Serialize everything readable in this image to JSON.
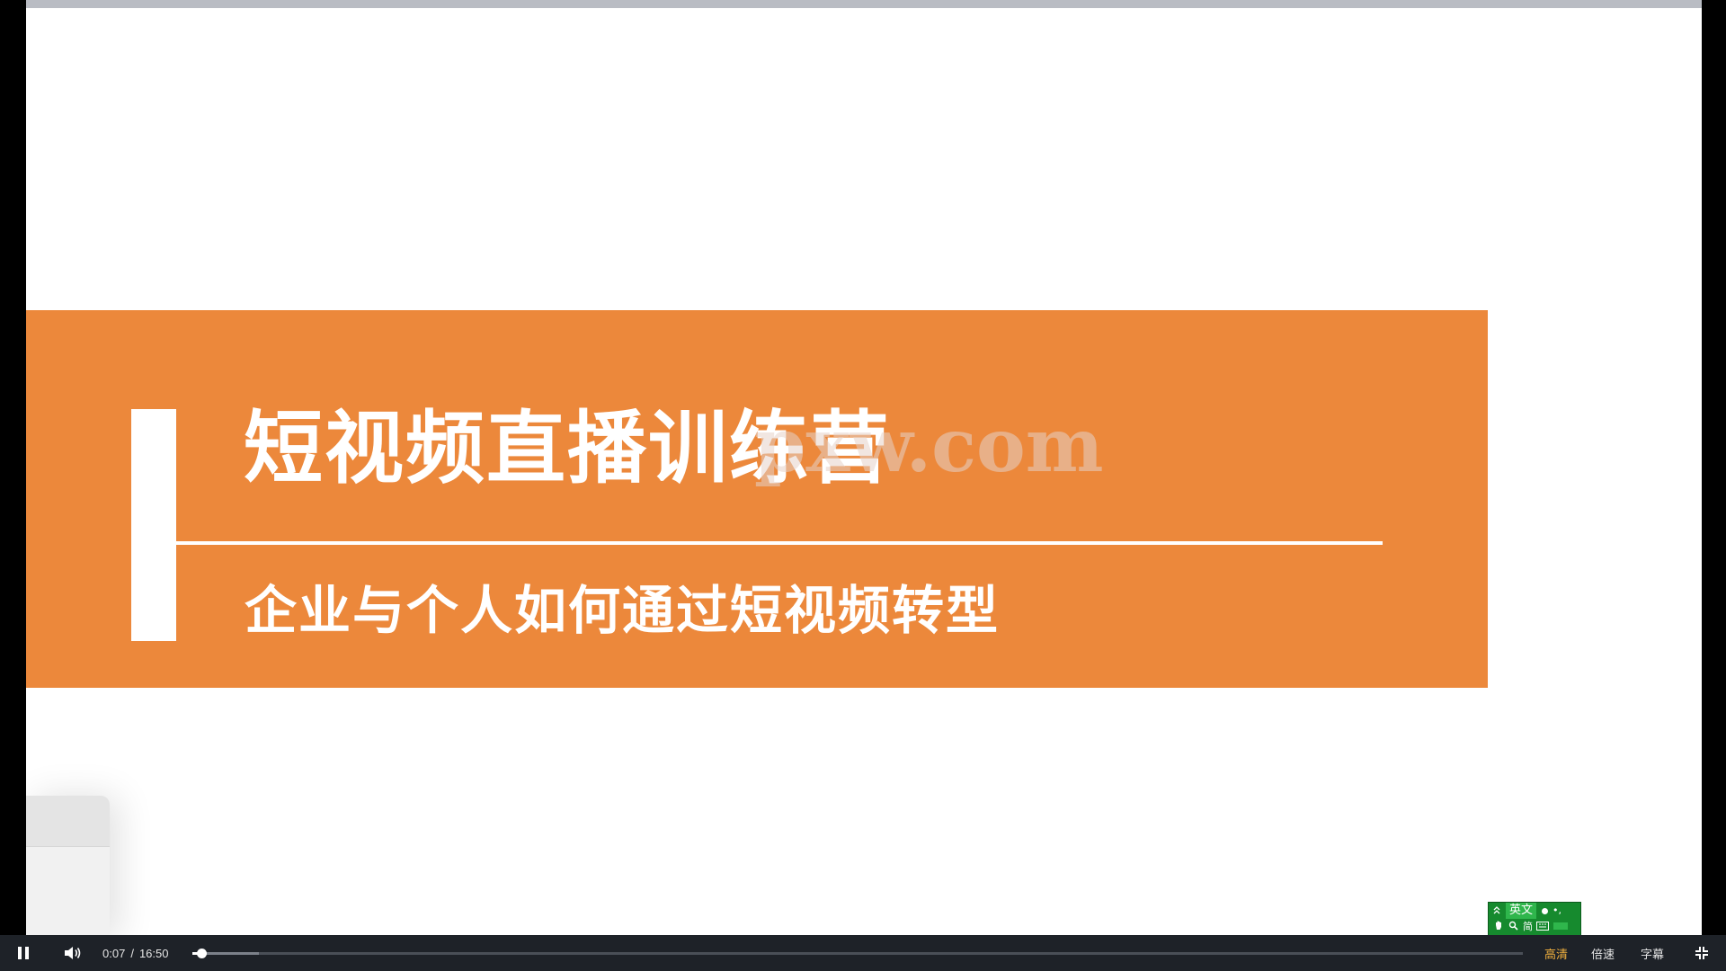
{
  "slide": {
    "title": "短视频直播训练营",
    "subtitle": "企业与个人如何通过短视频转型",
    "watermark": "pxw.com",
    "accent_color": "#ec883b"
  },
  "ime": {
    "language": "英文",
    "mode": "简",
    "icons": [
      "collapse-icon",
      "dot-icon",
      "punctuation-icon",
      "hand-icon",
      "search-icon",
      "keyboard-icon"
    ]
  },
  "player": {
    "current_time": "0:07",
    "separator": "/",
    "duration": "16:50",
    "progress_fraction": 0.007,
    "buffered_fraction": 0.05,
    "quality_label": "高清",
    "speed_label": "倍速",
    "subtitle_label": "字幕",
    "icons": [
      "pause-icon",
      "volume-icon",
      "exit-fullscreen-icon"
    ]
  }
}
